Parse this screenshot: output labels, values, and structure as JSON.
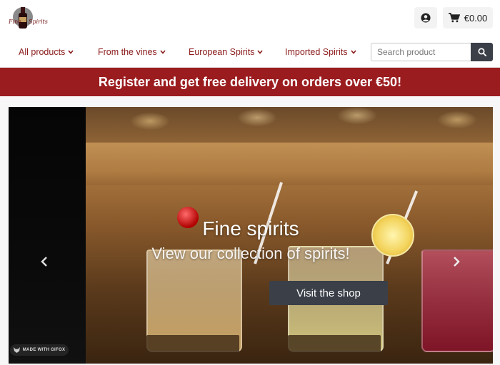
{
  "header": {
    "logo_text_left": "Fine",
    "logo_text_right": "Spirits",
    "cart_total": "€0.00"
  },
  "nav": {
    "items": [
      {
        "label": "All products"
      },
      {
        "label": "From the vines"
      },
      {
        "label": "European Spirits"
      },
      {
        "label": "Imported Spirits"
      }
    ],
    "search_placeholder": "Search product"
  },
  "promo": {
    "text": "Register and get free delivery on orders over €50!"
  },
  "hero": {
    "title": "Fine spirits",
    "subtitle": "View our collection of spirits!",
    "button_label": "Visit the shop",
    "watermark": "MADE WITH GIFOX"
  },
  "colors": {
    "brand": "#9b1c1f",
    "nav_text": "#8b1a1a",
    "button": "#3a3f48"
  }
}
